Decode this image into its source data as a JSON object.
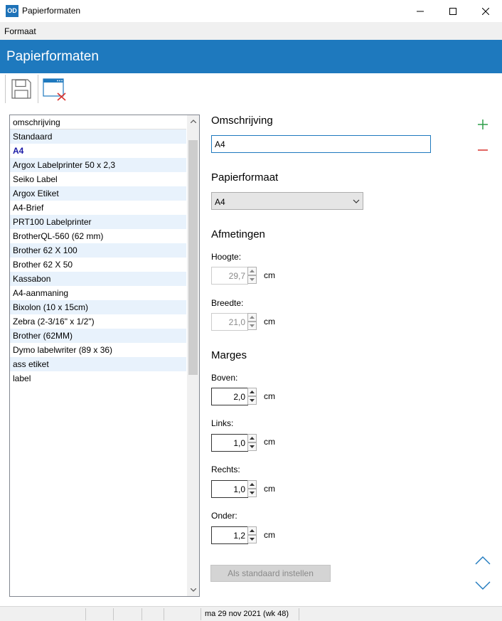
{
  "window": {
    "app_icon": "OD",
    "title": "Papierformaten"
  },
  "menu": {
    "items": [
      "Formaat"
    ]
  },
  "header": {
    "title": "Papierformaten"
  },
  "toolbar": {
    "save_icon": "save-icon",
    "close_icon": "close-window-icon"
  },
  "list": {
    "header": "omschrijving",
    "items": [
      "Standaard",
      "A4",
      "Argox Labelprinter 50 x 2,3",
      "Seiko Label",
      "Argox Etiket",
      "A4-Brief",
      "PRT100 Labelprinter",
      "BrotherQL-560 (62 mm)",
      "Brother 62 X 100",
      "Brother 62 X 50",
      "Kassabon",
      "A4-aanmaning",
      "Bixolon (10 x 15cm)",
      "Zebra (2-3/16\" x 1/2\")",
      "Brother (62MM)",
      "Dymo labelwriter (89 x 36)",
      "ass etiket",
      "label"
    ],
    "selected_index": 1
  },
  "form": {
    "description_title": "Omschrijving",
    "description_value": "A4",
    "paper_title": "Papierformaat",
    "paper_value": "A4",
    "dimensions_title": "Afmetingen",
    "height_label": "Hoogte:",
    "height_value": "29,7",
    "width_label": "Breedte:",
    "width_value": "21,0",
    "margins_title": "Marges",
    "top_label": "Boven:",
    "top_value": "2,0",
    "left_label": "Links:",
    "left_value": "1,0",
    "right_label": "Rechts:",
    "right_value": "1,0",
    "bottom_label": "Onder:",
    "bottom_value": "1,2",
    "unit": "cm",
    "default_button": "Als standaard instellen"
  },
  "colors": {
    "accent": "#1e79be",
    "add": "#2e9e48",
    "remove": "#d9322e",
    "row_alt": "#e8f2fc"
  },
  "status": {
    "date": "ma 29 nov 2021 (wk 48)"
  }
}
